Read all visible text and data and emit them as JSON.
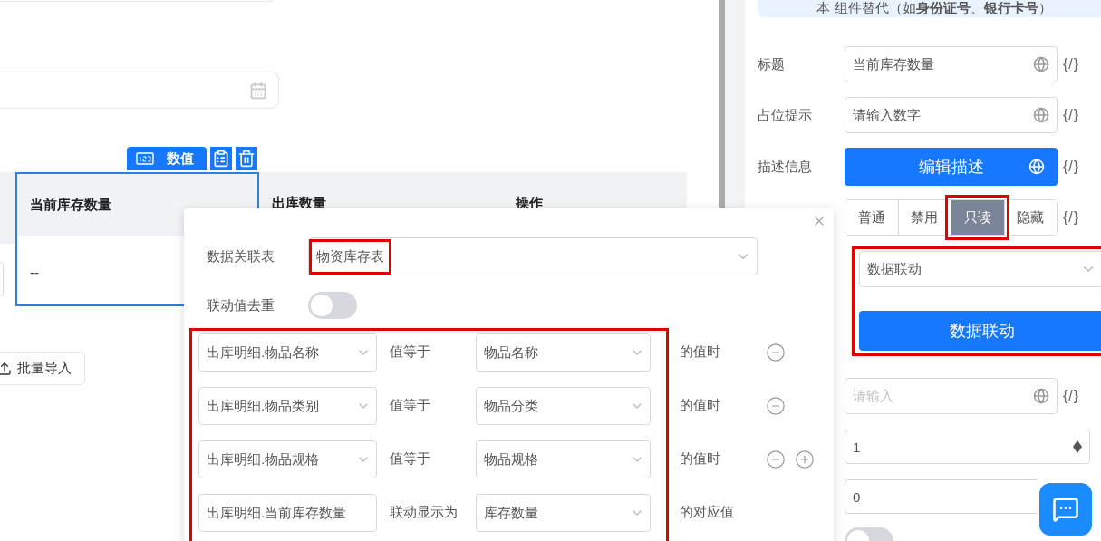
{
  "canvas": {
    "component_toolbar": {
      "type_label": "数值"
    },
    "table": {
      "columns": [
        {
          "label": "当前库存数量",
          "selected": true
        },
        {
          "label": "出库数量",
          "selected": false
        },
        {
          "label": "操作",
          "selected": false
        }
      ],
      "cell": "--"
    },
    "batch_import_button": "批量导入"
  },
  "properties": {
    "banner": "本 组件替代（如**身份证号**、**银行卡号**）",
    "title_field": {
      "label": "标题",
      "value": "当前库存数量",
      "var": "{/}"
    },
    "placeholder_field": {
      "label": "占位提示",
      "value": "请输入数字",
      "var": "{/}"
    },
    "description": {
      "label": "描述信息",
      "button": "编辑描述",
      "var": "{/}"
    },
    "status": {
      "var": "{/}",
      "options": [
        {
          "label": "普通",
          "selected": false,
          "highlighted": false
        },
        {
          "label": "禁用",
          "selected": false,
          "highlighted": false
        },
        {
          "label": "只读",
          "selected": true,
          "highlighted": true
        },
        {
          "label": "隐藏",
          "selected": false,
          "highlighted": false
        }
      ]
    },
    "linkage": {
      "highlighted": true,
      "mode": "数据联动",
      "button": "数据联动"
    },
    "default_field": {
      "placeholder": "请输入",
      "var": "{/}"
    },
    "stepper_field": {
      "value": "1"
    },
    "field_8": {
      "value": "0"
    },
    "toggle": {
      "on": false
    }
  },
  "popover": {
    "source_table": {
      "label": "数据关联表",
      "value": "物资库存表",
      "highlighted": true
    },
    "dedupe": {
      "label": "联动值去重",
      "on": false
    },
    "rules": {
      "highlighted": true,
      "items": [
        {
          "kind": "match",
          "field": "出库明细.物品名称",
          "operator": "值等于",
          "target": "物品名称",
          "suffix": "的值时",
          "removable": true,
          "addable": false
        },
        {
          "kind": "match",
          "field": "出库明细.物品类别",
          "operator": "值等于",
          "target": "物品分类",
          "suffix": "的值时",
          "removable": true,
          "addable": false
        },
        {
          "kind": "match",
          "field": "出库明细.物品规格",
          "operator": "值等于",
          "target": "物品规格",
          "suffix": "的值时",
          "removable": true,
          "addable": true
        },
        {
          "kind": "output",
          "field": "出库明细.当前库存数量",
          "operator": "联动显示为",
          "target": "库存数量",
          "suffix": "的对应值",
          "removable": false,
          "addable": false
        }
      ]
    }
  }
}
